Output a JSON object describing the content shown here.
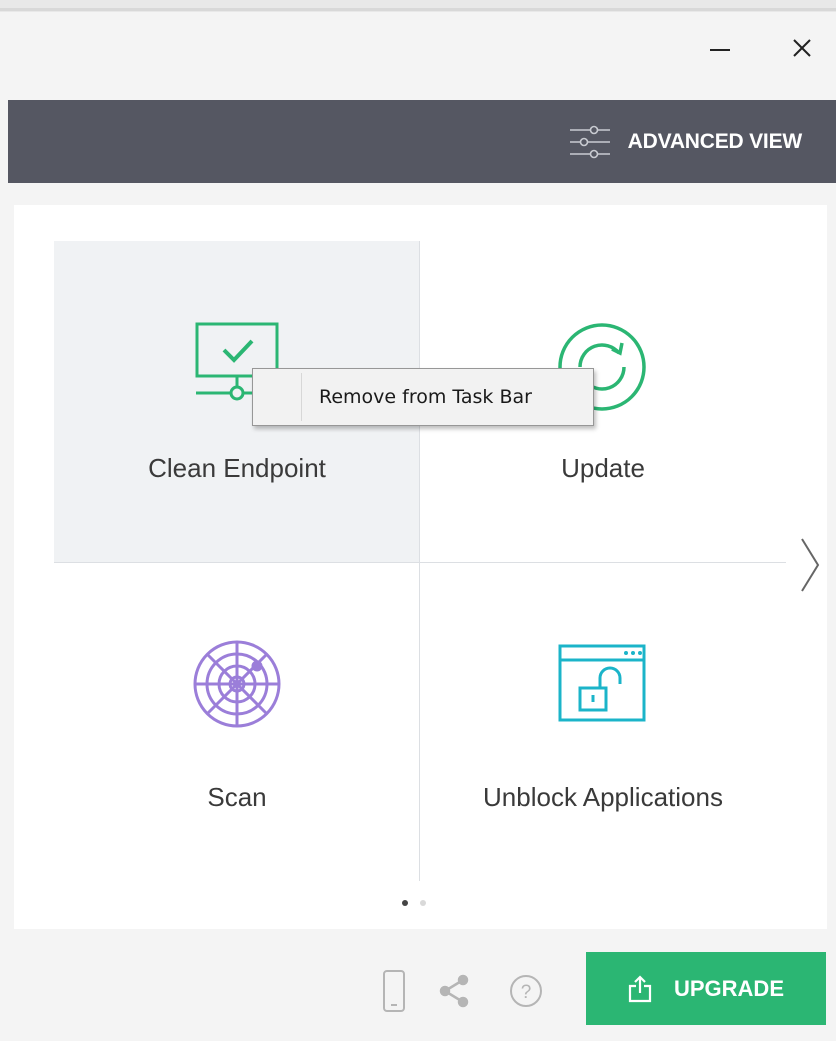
{
  "window": {
    "minimize_icon": "minimize-icon",
    "close_icon": "close-icon"
  },
  "toolbar": {
    "advanced_view_label": "ADVANCED VIEW",
    "advanced_view_icon": "sliders-icon"
  },
  "tiles": [
    {
      "label": "Clean Endpoint",
      "icon": "monitor-check-icon",
      "color": "#2bb673"
    },
    {
      "label": "Update",
      "icon": "refresh-icon",
      "color": "#2bb673"
    },
    {
      "label": "Scan",
      "icon": "radar-icon",
      "color": "#9b7ed9"
    },
    {
      "label": "Unblock Applications",
      "icon": "unlock-window-icon",
      "color": "#1bb4c9"
    }
  ],
  "context_menu": {
    "items": [
      {
        "label": "Remove from Task Bar"
      }
    ]
  },
  "pagination": {
    "pages": 2,
    "current": 1
  },
  "bottom": {
    "icons": [
      "mobile-icon",
      "share-icon",
      "help-icon"
    ],
    "upgrade_label": "UPGRADE",
    "upgrade_icon": "upload-icon",
    "upgrade_color": "#2bb673"
  }
}
